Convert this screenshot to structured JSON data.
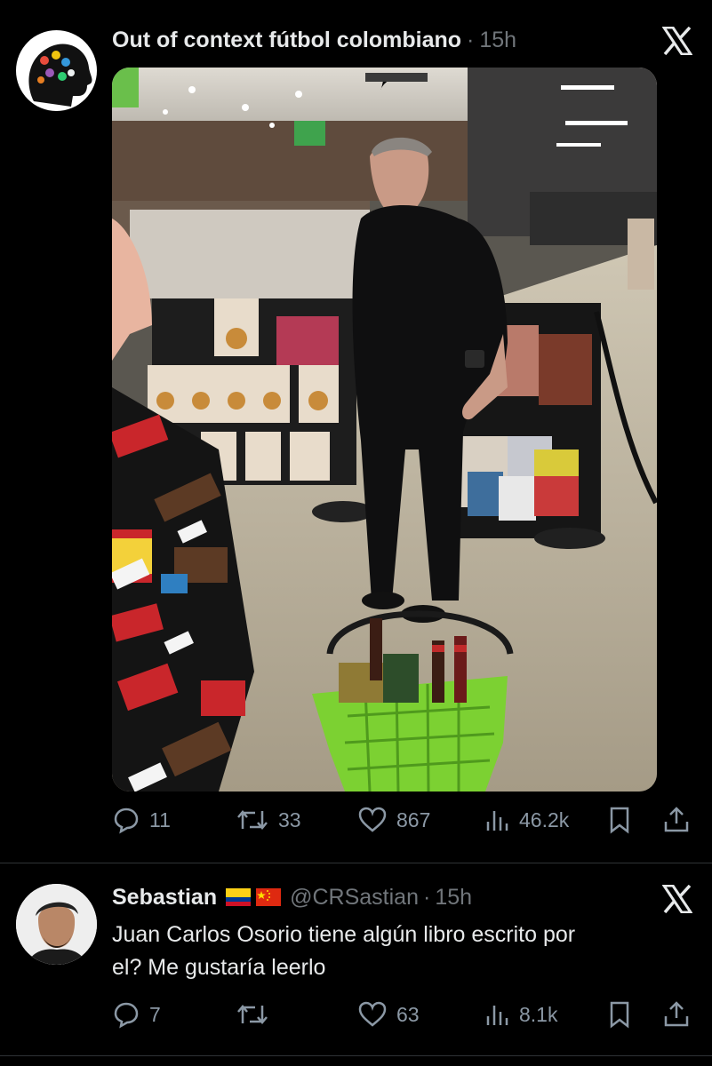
{
  "tweet": {
    "author": "Out of context fútbol colombiano",
    "separator": "·",
    "time": "15h",
    "media_label": "tweet photo",
    "stats": {
      "replies": "11",
      "retweets": "33",
      "likes": "867",
      "views": "46.2k"
    }
  },
  "reply": {
    "author": "Sebastian",
    "flags": [
      "colombia-flag",
      "china-flag"
    ],
    "handle": "@CRSastian",
    "separator": "·",
    "time": "15h",
    "text_line1": "Juan Carlos Osorio tiene algún libro escrito por",
    "text_line2": "el? Me gustaría leerlo",
    "stats": {
      "replies": "7",
      "retweets": "",
      "likes": "63",
      "views": "8.1k"
    }
  },
  "colors": {
    "background": "#000000",
    "text": "#e7e9ea",
    "muted": "#71767b",
    "icon": "#8b98a5",
    "divider": "#2f3336",
    "basket": "#7cd132"
  }
}
